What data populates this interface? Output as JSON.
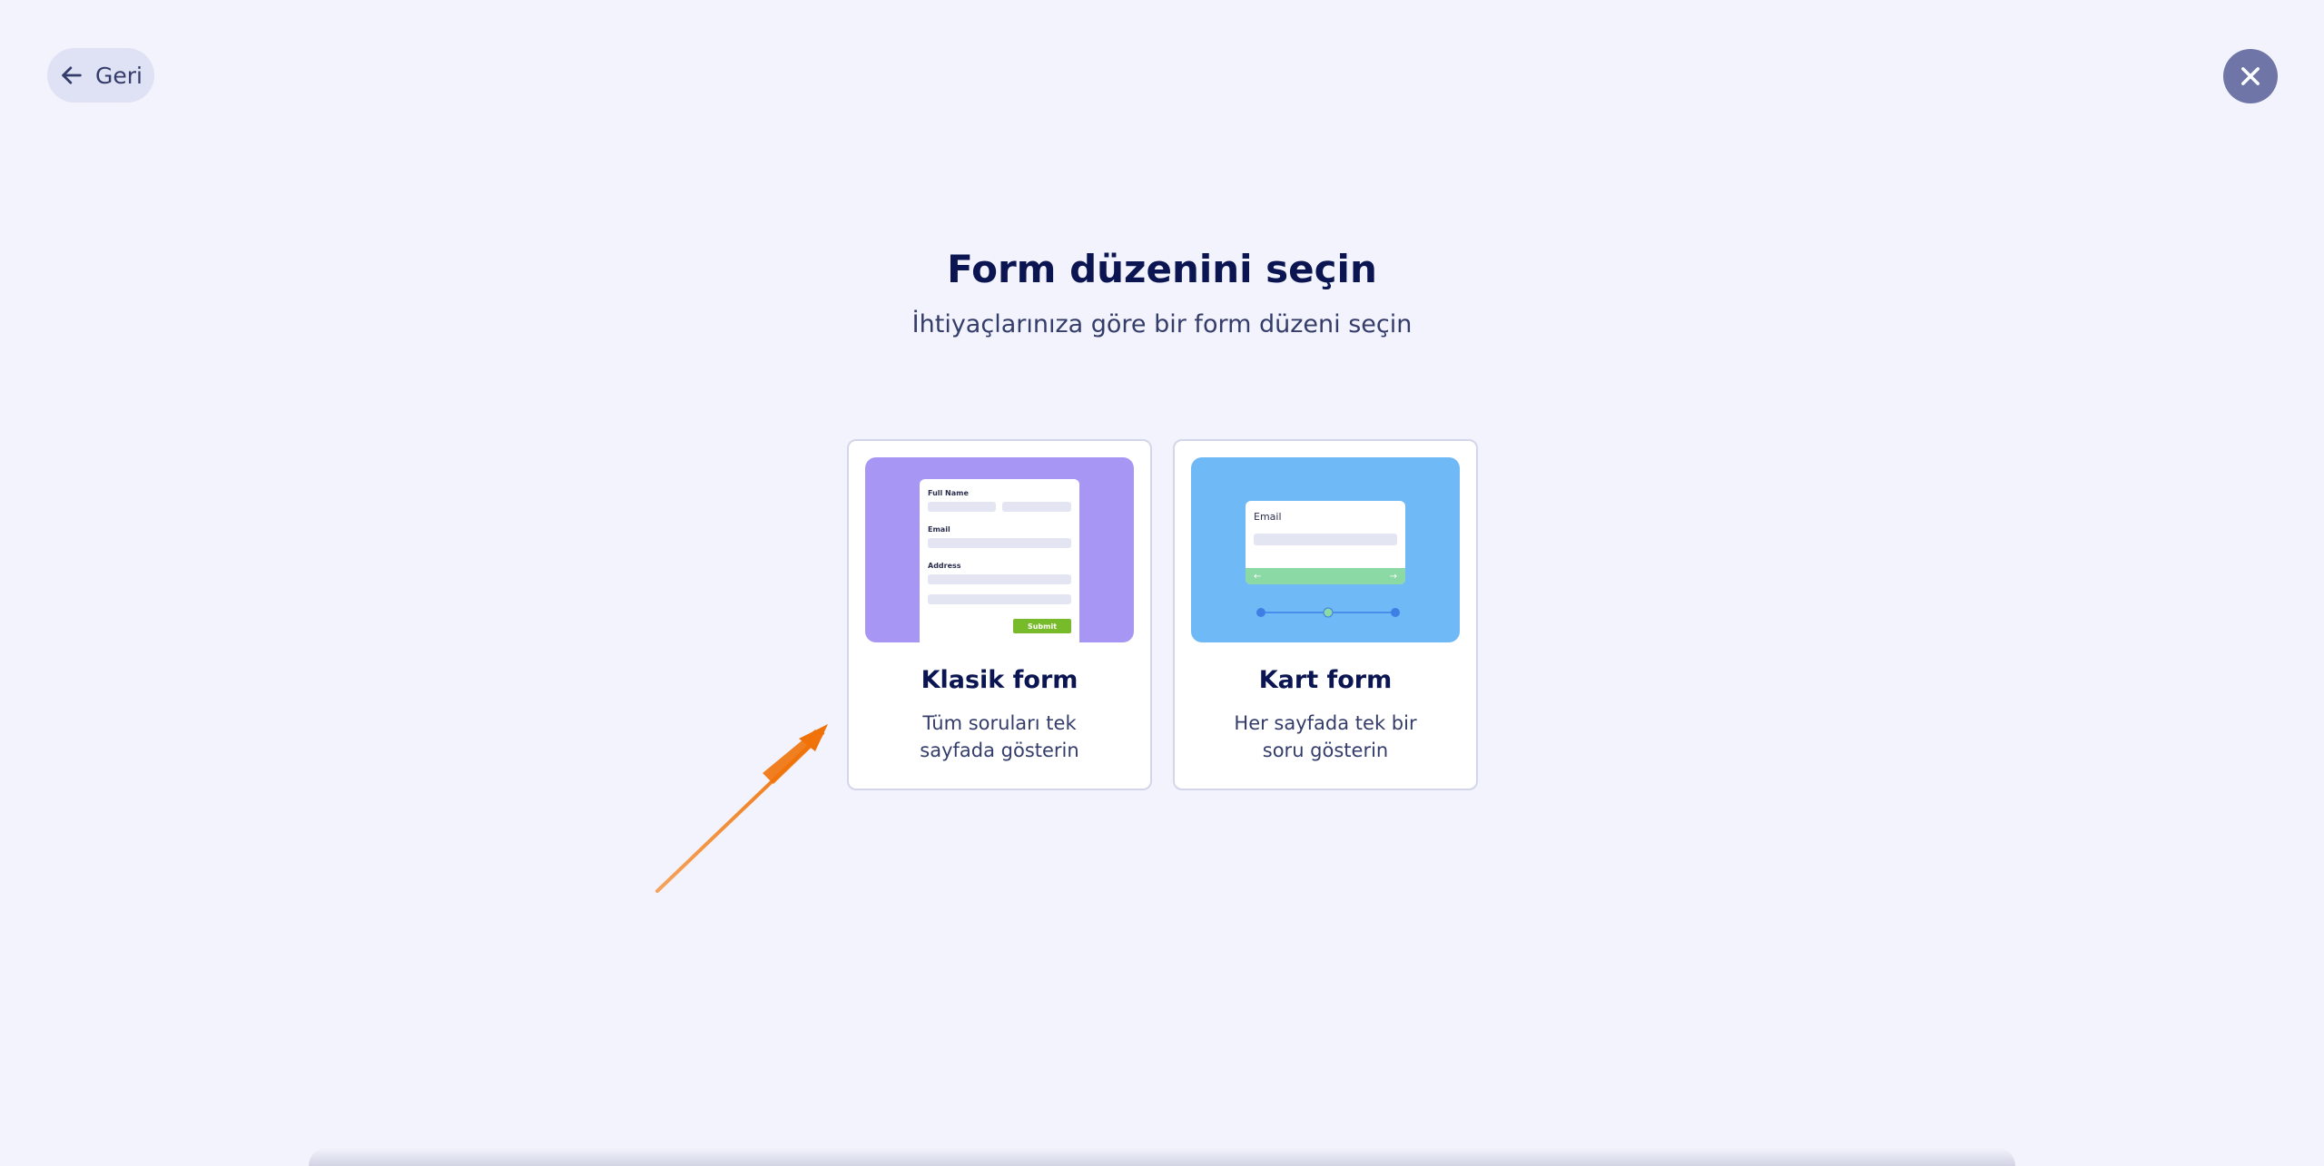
{
  "header": {
    "back_label": "Geri"
  },
  "main": {
    "title": "Form düzenini seçin",
    "subtitle": "İhtiyaçlarınıza göre bir form düzeni seçin"
  },
  "options": [
    {
      "title": "Klasik form",
      "description": "Tüm soruları tek sayfada gösterin",
      "preview": {
        "full_name_label": "Full Name",
        "email_label": "Email",
        "address_label": "Address",
        "submit_label": "Submit"
      }
    },
    {
      "title": "Kart form",
      "description": "Her sayfada tek bir soru gösterin",
      "preview": {
        "email_label": "Email",
        "prev_arrow": "←",
        "next_arrow": "→"
      }
    }
  ],
  "colors": {
    "background": "#f2f3fc",
    "classic_preview": "#a896f4",
    "card_preview": "#6fb9f6",
    "submit_green": "#78bb2a",
    "arrow_orange": "#f07d0f",
    "close_button": "#6f76a7"
  }
}
